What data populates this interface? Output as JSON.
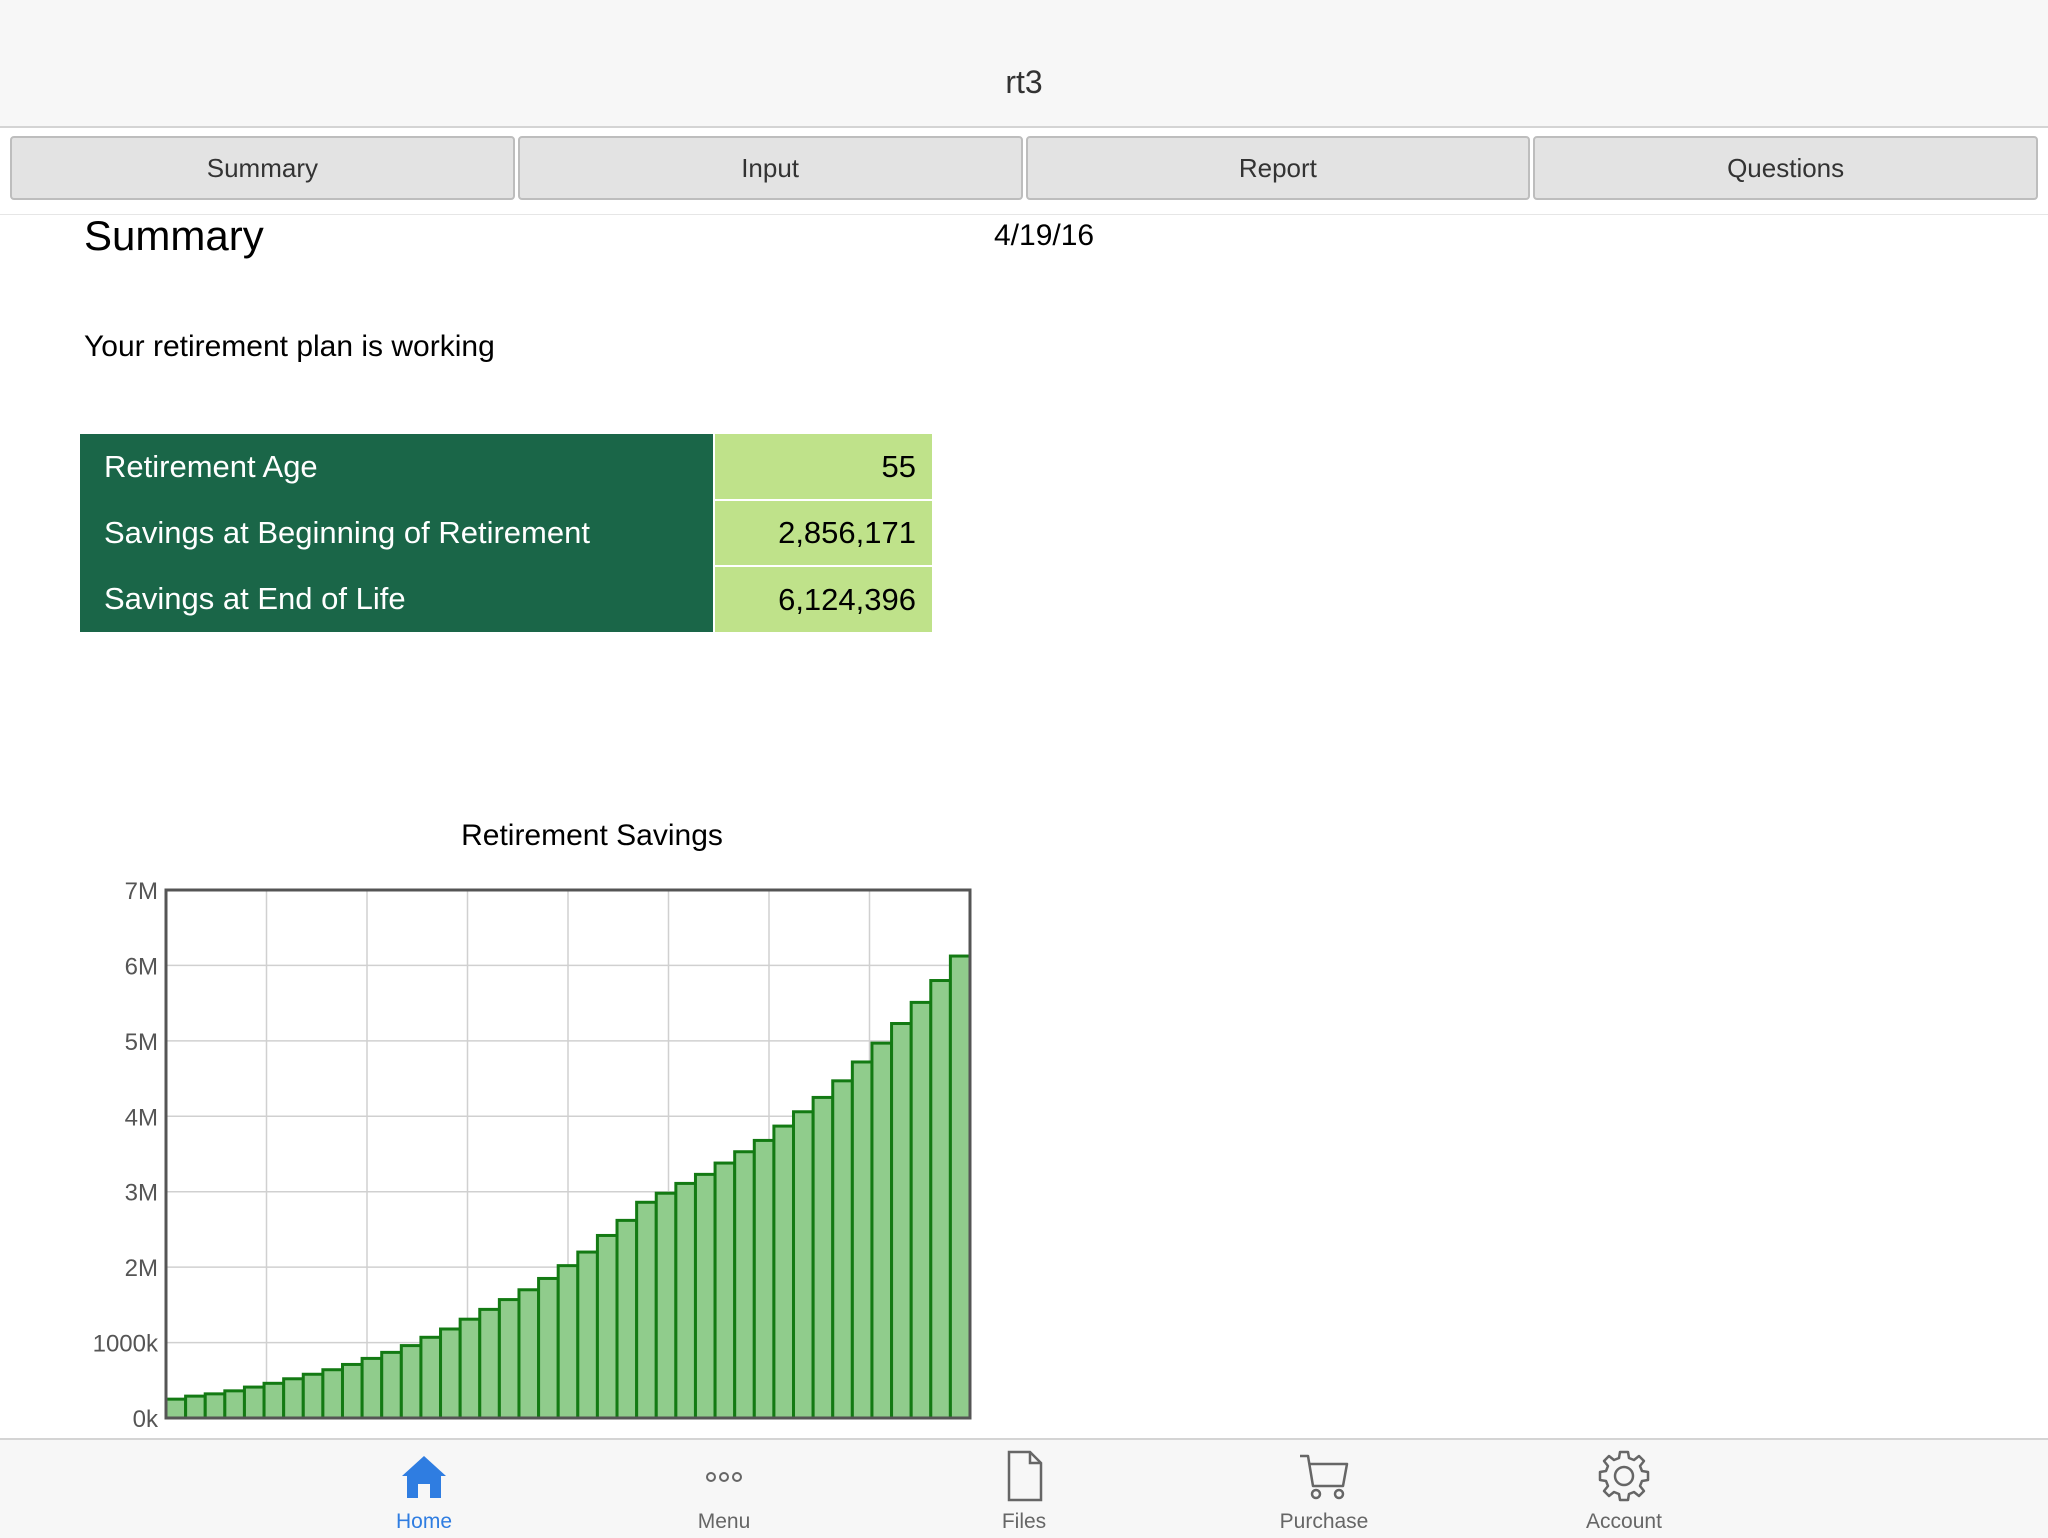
{
  "app": {
    "title": "rt3"
  },
  "tabs": [
    {
      "label": "Summary"
    },
    {
      "label": "Input"
    },
    {
      "label": "Report"
    },
    {
      "label": "Questions"
    }
  ],
  "page": {
    "heading": "Summary",
    "date": "4/19/16",
    "status": "Your retirement plan is working"
  },
  "summary_rows": [
    {
      "label": "Retirement Age",
      "value": "55"
    },
    {
      "label": "Savings at Beginning of Retirement",
      "value": "2,856,171"
    },
    {
      "label": "Savings at End of Life",
      "value": "6,124,396"
    }
  ],
  "colors": {
    "table_label_bg": "#1a6648",
    "table_value_bg": "#bfe28a",
    "bar_fill": "#90cc8c",
    "bar_stroke": "#137a13",
    "nav_active": "#2f7de1"
  },
  "chart_data": {
    "type": "bar",
    "title": "Retirement Savings",
    "xlabel": "",
    "ylabel": "",
    "ylim": [
      0,
      7000000
    ],
    "yticks": [
      {
        "value": 0,
        "label": "0k"
      },
      {
        "value": 1000000,
        "label": "1000k"
      },
      {
        "value": 2000000,
        "label": "2M"
      },
      {
        "value": 3000000,
        "label": "3M"
      },
      {
        "value": 4000000,
        "label": "4M"
      },
      {
        "value": 5000000,
        "label": "5M"
      },
      {
        "value": 6000000,
        "label": "6M"
      },
      {
        "value": 7000000,
        "label": "7M"
      }
    ],
    "grid": true,
    "values": [
      250000,
      290000,
      320000,
      360000,
      410000,
      460000,
      520000,
      580000,
      640000,
      710000,
      790000,
      870000,
      960000,
      1070000,
      1180000,
      1310000,
      1440000,
      1570000,
      1700000,
      1850000,
      2020000,
      2200000,
      2420000,
      2620000,
      2860000,
      2980000,
      3110000,
      3230000,
      3380000,
      3530000,
      3680000,
      3870000,
      4060000,
      4250000,
      4470000,
      4720000,
      4970000,
      5230000,
      5510000,
      5800000,
      6124396
    ]
  },
  "bottom_nav": [
    {
      "label": "Home",
      "icon": "home-icon",
      "active": true
    },
    {
      "label": "Menu",
      "icon": "more-icon",
      "active": false
    },
    {
      "label": "Files",
      "icon": "file-icon",
      "active": false
    },
    {
      "label": "Purchase",
      "icon": "cart-icon",
      "active": false
    },
    {
      "label": "Account",
      "icon": "gear-icon",
      "active": false
    }
  ]
}
